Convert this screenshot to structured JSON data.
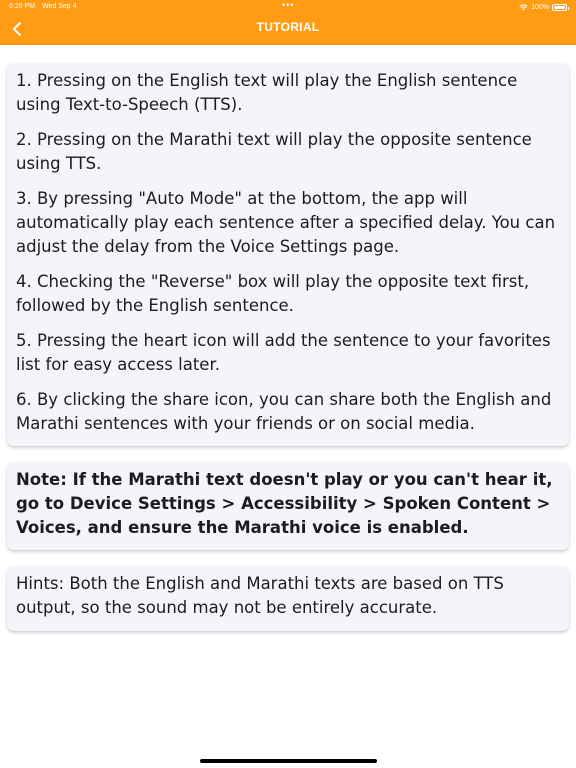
{
  "status_bar": {
    "time": "6:20 PM",
    "date": "Wed Sep 4",
    "dots": "•••",
    "battery": "100%"
  },
  "header": {
    "title": "TUTORIAL",
    "back_icon": "chevron-left-icon"
  },
  "colors": {
    "header_background": "#ff9c14",
    "card_background": "#f7f3fb",
    "text": "#1d1b20"
  },
  "tutorial": {
    "steps": [
      "1. Pressing on the English text will play the English sentence using Text-to-Speech (TTS).",
      "2. Pressing on the Marathi text will play the opposite sentence using TTS.",
      "3. By pressing \"Auto Mode\" at the bottom, the app will automatically play each sentence after a specified delay. You can adjust the delay from the Voice Settings page.",
      "4. Checking the \"Reverse\" box will play the opposite text first, followed by the English sentence.",
      "5. Pressing the heart icon will add the sentence to your favorites list for easy access later.",
      "6. By clicking the share icon, you can share both the English and Marathi sentences with your friends or on social media."
    ]
  },
  "note": {
    "text": "Note: If the Marathi text doesn't play or you can't hear it, go to Device Settings > Accessibility > Spoken Content > Voices, and ensure the Marathi voice is enabled."
  },
  "hints": {
    "text": "Hints: Both the English and Marathi texts are based on TTS output, so the sound may not be entirely accurate."
  }
}
